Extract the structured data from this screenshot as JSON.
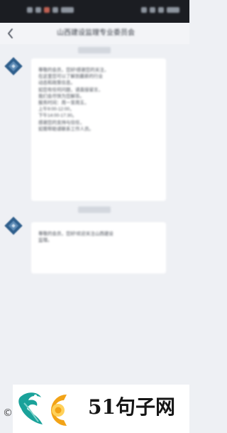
{
  "nav": {
    "title": "山西建设监理专业委员会"
  },
  "messages": [
    {
      "sender": "official-account",
      "lines": [
        "尊敬的会员，您好!感谢您的关注，",
        "在这里您可以了解到最新的行业",
        "动态和政策信息。",
        "如您有任何问题，请直接留言，",
        "我们会尽快为您解答。",
        "服务时间：周一至周五，",
        "上午9:00-12:00，",
        "下午14:00-17:30。",
        "感谢您的支持与信任，",
        "如需帮助请联系工作人员。"
      ]
    },
    {
      "sender": "official-account",
      "lines": [
        "尊敬的会员，您好!欢迎关注山西建设",
        "监理。"
      ]
    }
  ],
  "watermark": {
    "text": "51句子网"
  },
  "colors": {
    "status_bar": "#1b1d22",
    "nav_bar": "#f3f4f7",
    "chat_bg": "#eef0f4",
    "bubble_bg": "#ffffff",
    "avatar_blue": "#2f5f8c",
    "logo_teal": "#1aa29a",
    "logo_orange": "#f2a317"
  }
}
